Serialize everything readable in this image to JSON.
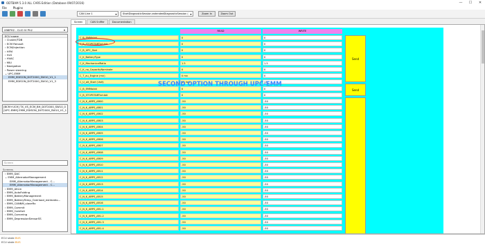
{
  "window": {
    "title": "ODTBAM 5.3.0 ALL CARS Edition (Database 09/07/2016)",
    "controls": [
      "—",
      "☐",
      "✕"
    ]
  },
  "menu": [
    "File",
    "Plugins"
  ],
  "toolbar": {
    "can_line": "CAN Line 1",
    "session": "StartDiagnosticSession.extendedDiagnosticSession (3C)",
    "zoom_in": "Zoom In",
    "zoom_out": "Zoom Out"
  },
  "left": {
    "vehicle": "X98PH2 - CLIO IV Ph2",
    "ecu_tree": [
      "ECU name",
      "Cluster/TDB",
      "ECM Renault",
      "ECM/Injection",
      "HFM",
      "HLS",
      "HVAC",
      "MIU",
      "Navigation",
      "Power steering",
      "UPC-EMM",
      "EMM_EDISON_D0T2000_SW10_V1_1",
      "EMM_EDISON_D0T2000_SW10_V1_3"
    ],
    "ecu_info": [
      "[BCM+UCH] TX_VS_ECM_BH_D0T2000_SW10_0",
      "[UPC-EMM] EMM_EDISON_D0T2000_SW10_V1_1"
    ],
    "filter_label": "Screen",
    "screens_label": "Screens",
    "screens": [
      "EMM_DAC",
      "EMM_AlternatorManagement",
      "EMM_AlternatorManagement - C...",
      "EMM_AlternatorManagement - C...",
      "EMM_AltLin",
      "EMM_AutoFolding",
      "EMM_BatteryManagement",
      "EMM_BatteryTemp_Overload_estimatio...",
      "EMM_CANNM_slaveRx",
      "EMM_Commit",
      "EMM_Comfort",
      "EMM_Cornering",
      "EMM_DepressionSensorSS"
    ]
  },
  "tabs": [
    "Screen",
    "CAN Sniffer",
    "Documentation"
  ],
  "table": {
    "read_header": "READ",
    "write_header": "WRITE",
    "send_label": "Send",
    "rows": [
      {
        "name": "C_B_EMMoldd",
        "read": "0",
        "write": "0"
      },
      {
        "name": "C_B_STOPSTARTinhibit",
        "read": "0",
        "write": "0"
      },
      {
        "name": "C_B_UPC_Stat",
        "read": "0",
        "write": "0"
      },
      {
        "name": "C_K_BatteryType",
        "read": "0",
        "write": "0"
      },
      {
        "name": "C_K_MechanicalRatio",
        "read": "1.5",
        "write": "1.5"
      },
      {
        "name": "C_K_no_CapacityNominale",
        "read": "0",
        "write": "0"
      },
      {
        "name": "C_T_au_Engine (mn)",
        "read": "0 mn",
        "write": "0"
      },
      {
        "name": "C_U_alt_Start (Volt)",
        "read": "13 Volt",
        "write": "13"
      },
      {
        "name": "C_B_EMMoldd",
        "read": "0",
        "write": "0"
      },
      {
        "name": "C_B_STOPSTARTinhibit",
        "read": "0",
        "write": "0"
      },
      {
        "name": "C_N_K_ARPS_AR00",
        "read": "-50",
        "write": "-50"
      },
      {
        "name": "C_N_K_ARPS_AR01",
        "read": "-50",
        "write": "-50"
      },
      {
        "name": "C_N_K_ARPS_AR02",
        "read": "-50",
        "write": "-50"
      },
      {
        "name": "C_N_K_ARPS_AR03",
        "read": "-50",
        "write": "-50"
      },
      {
        "name": "C_N_K_ARPS_AR04",
        "read": "-50",
        "write": "-50"
      },
      {
        "name": "C_N_K_ARPS_AR05",
        "read": "-50",
        "write": "-50"
      },
      {
        "name": "C_N_K_ARPS_AR06",
        "read": "-50",
        "write": "-50"
      },
      {
        "name": "C_N_K_ARPS_AR07",
        "read": "-50",
        "write": "-50"
      },
      {
        "name": "C_N_K_ARPS_AR08",
        "read": "-50",
        "write": "-50"
      },
      {
        "name": "C_N_K_ARPS_AR09",
        "read": "-50",
        "write": "-50"
      },
      {
        "name": "C_N_K_ARPS_AR10",
        "read": "-50",
        "write": "-50"
      },
      {
        "name": "C_N_K_ARPS_AR11",
        "read": "-50",
        "write": "-50"
      },
      {
        "name": "C_N_K_ARPS_AR12",
        "read": "-50",
        "write": "-50"
      },
      {
        "name": "C_N_K_ARPS_AR13",
        "read": "-50",
        "write": "-50"
      },
      {
        "name": "C_N_K_ARPS_AR14",
        "read": "-50",
        "write": "-50"
      },
      {
        "name": "C_N_K_ARPS_AR15",
        "read": "-50",
        "write": "-50"
      },
      {
        "name": "C_N_K_ARPS_AR16",
        "read": "-50",
        "write": "-50"
      },
      {
        "name": "C_N_K_ARPS_AR1.1",
        "read": "-50",
        "write": "-50"
      },
      {
        "name": "C_N_K_ARPS_AR1.2",
        "read": "-50",
        "write": "-50"
      },
      {
        "name": "C_N_K_ARPS_AR1.3",
        "read": "-50",
        "write": "-50"
      },
      {
        "name": "C_N_K_ARPS_AR1.4",
        "read": "-50",
        "write": "-50"
      }
    ]
  },
  "overlay_text": "SECOND OPTION THROUGH UPC-EMM",
  "status": [
    {
      "label": "ECU state",
      "value": "BUS"
    },
    {
      "label": "ECU state",
      "value": "BUS"
    }
  ],
  "colors": {
    "grid_bg": "#00ffff",
    "header": "#ee82ee",
    "read_cell": "#ffff99",
    "send_button": "#ffff00",
    "overlay": "#3a86ff",
    "highlight": "#e0241b"
  }
}
